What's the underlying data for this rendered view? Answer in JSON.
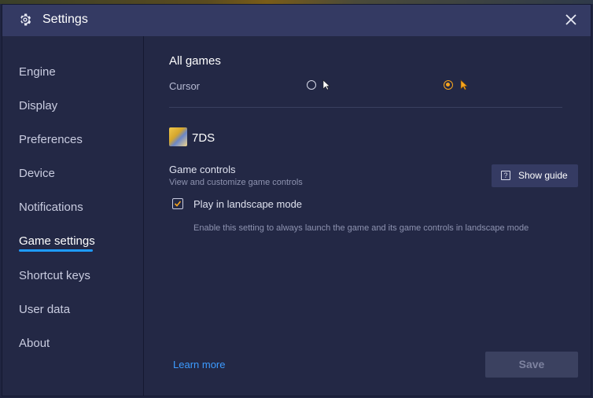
{
  "window": {
    "title": "Settings"
  },
  "sidebar": {
    "items": [
      {
        "label": "Engine"
      },
      {
        "label": "Display"
      },
      {
        "label": "Preferences"
      },
      {
        "label": "Device"
      },
      {
        "label": "Notifications"
      },
      {
        "label": "Game settings",
        "active": true
      },
      {
        "label": "Shortcut keys"
      },
      {
        "label": "User data"
      },
      {
        "label": "About"
      }
    ]
  },
  "main": {
    "section_title": "All games",
    "cursor": {
      "label": "Cursor",
      "options": [
        {
          "icon": "cursor-white-icon",
          "selected": false
        },
        {
          "icon": "cursor-orange-icon",
          "selected": true
        }
      ]
    },
    "game": {
      "name": "7DS",
      "icon": "game-thumbnail"
    },
    "game_controls": {
      "title": "Game controls",
      "subtitle": "View and customize game controls",
      "guide_button": "Show guide"
    },
    "landscape": {
      "label": "Play in landscape mode",
      "checked": true,
      "description": "Enable this setting to always launch the game and its game controls in landscape mode"
    },
    "learn_more": "Learn more",
    "save": "Save"
  },
  "colors": {
    "accent": "#1e9bff",
    "radio_selected": "#f7a51f",
    "link": "#3c9bff",
    "background": "#232845",
    "titlebar": "#343a63"
  }
}
